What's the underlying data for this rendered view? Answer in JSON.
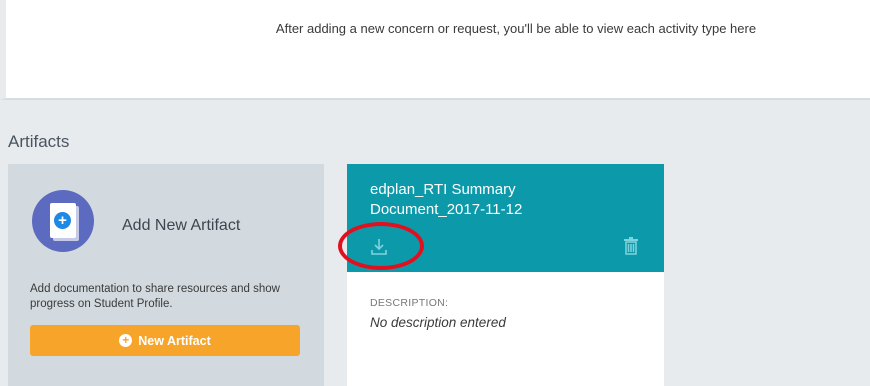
{
  "activity_panel": {
    "message": "After adding a new concern or request, you'll be able to view each activity type here"
  },
  "artifacts": {
    "section_title": "Artifacts",
    "add_card": {
      "title": "Add New Artifact",
      "description": "Add documentation to share resources and show progress on Student Profile.",
      "button_label": "New Artifact"
    },
    "items": [
      {
        "name": "edplan_RTI Summary Document_2017-11-12",
        "description_label": "DESCRIPTION:",
        "description_value": "No description entered"
      }
    ]
  },
  "colors": {
    "accent_teal": "#0c9aaa",
    "button_orange": "#f6a42a",
    "annotation_red": "#e0101e",
    "avatar_indigo": "#5c6bc0"
  },
  "icons": {
    "avatar": "document-plus-icon",
    "button": "plus-circle-icon",
    "download": "download-icon",
    "delete": "trash-icon"
  }
}
